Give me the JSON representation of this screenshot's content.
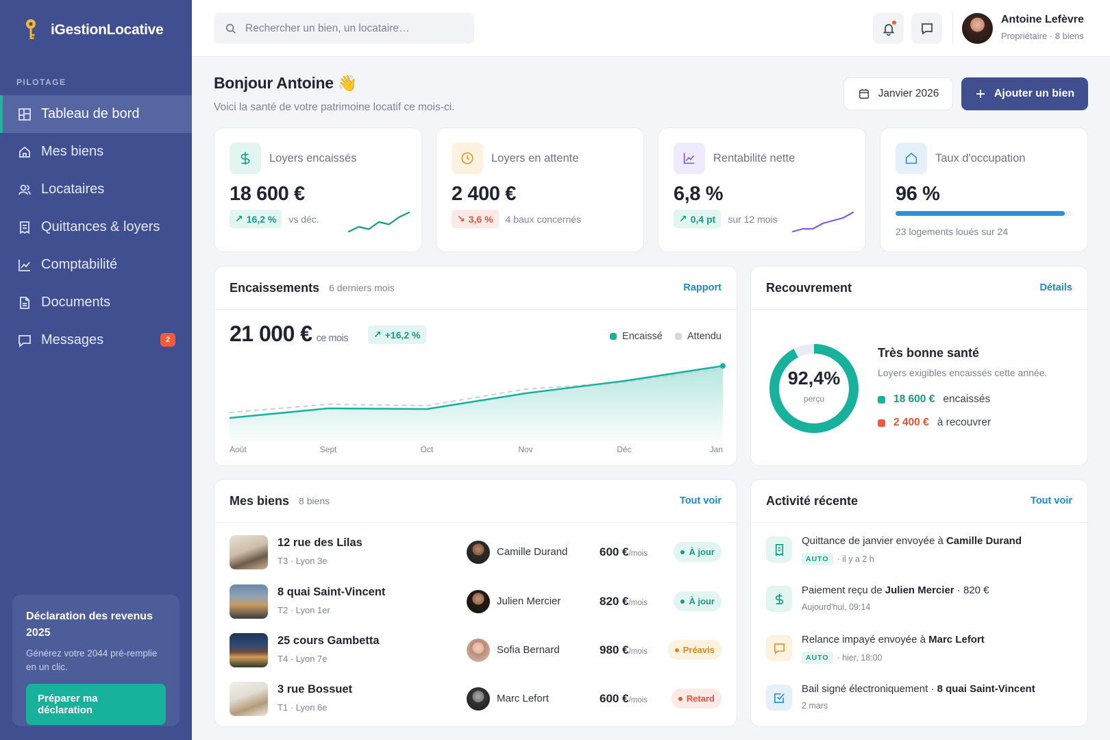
{
  "app": {
    "name": "iGestionLocative"
  },
  "sidebar": {
    "section": "PILOTAGE",
    "items": [
      {
        "label": "Tableau de bord",
        "icon": "dashboard-icon",
        "active": true
      },
      {
        "label": "Mes biens",
        "icon": "home-icon"
      },
      {
        "label": "Locataires",
        "icon": "users-icon"
      },
      {
        "label": "Quittances & loyers",
        "icon": "receipt-icon"
      },
      {
        "label": "Comptabilité",
        "icon": "chart-line-icon"
      },
      {
        "label": "Documents",
        "icon": "document-icon"
      },
      {
        "label": "Messages",
        "icon": "message-icon",
        "badge": "2"
      }
    ],
    "promo": {
      "title": "Déclaration des revenus 2025",
      "text": "Générez votre 2044 pré-remplie en un clic.",
      "button": "Préparer ma déclaration"
    }
  },
  "topbar": {
    "search_placeholder": "Rechercher un bien, un locataire…",
    "user": {
      "name": "Antoine Lefèvre",
      "subtitle": "Propriétaire · 8 biens"
    }
  },
  "header": {
    "greeting": "Bonjour Antoine 👋",
    "subtitle": "Voici la santé de votre patrimoine locatif ce mois-ci.",
    "period": "Janvier 2026",
    "add_button": "Ajouter un bien"
  },
  "kpis": [
    {
      "label": "Loyers encaissés",
      "value": "18 600 €",
      "delta": "16,2 %",
      "trend": "up",
      "note": "vs déc.",
      "color": "#169a87",
      "spark": [
        3,
        5,
        4,
        7,
        6,
        9,
        11
      ]
    },
    {
      "label": "Loyers en attente",
      "value": "2 400 €",
      "delta": "3,6 %",
      "trend": "down",
      "note": "4 baux concernés",
      "color": "#e59a28"
    },
    {
      "label": "Rentabilité nette",
      "value": "6,8 %",
      "delta": "0,4 pt",
      "trend": "up",
      "note": "sur 12 mois",
      "color": "#7b5ce0",
      "spark": [
        2,
        3,
        3,
        5,
        6,
        7,
        9
      ]
    },
    {
      "label": "Taux d'occupation",
      "value": "96 %",
      "progress": 0.96,
      "note": "23 logements loués sur 24",
      "color": "#2e8fd6"
    }
  ],
  "encaissements": {
    "title": "Encaissements",
    "subtitle": "6 derniers mois",
    "link": "Rapport",
    "value": "21 000 €",
    "value_suffix": "ce mois",
    "delta": "+16,2 %",
    "legend": [
      "Encaissé",
      "Attendu"
    ]
  },
  "chart_data": {
    "type": "area",
    "categories": [
      "Août",
      "Sept",
      "Oct",
      "Nov",
      "Déc",
      "Jan"
    ],
    "series": [
      {
        "name": "Encaissé",
        "values": [
          17200,
          17900,
          17850,
          19000,
          19900,
          21000
        ],
        "color": "#18b29c"
      },
      {
        "name": "Attendu",
        "values": [
          17600,
          18200,
          18100,
          19300,
          19800,
          20800
        ],
        "color": "#c8cfdc"
      }
    ],
    "ylim": [
      15500,
      21500
    ]
  },
  "recouvrement": {
    "title": "Recouvrement",
    "link": "Détails",
    "percent": 0.924,
    "percent_label": "92,4%",
    "percent_sub": "perçu",
    "status": "Très bonne santé",
    "text": "Loyers exigibles encaissés cette année.",
    "collected": {
      "amount": "18 600 €",
      "label": "encaissés",
      "color": "#18b29c"
    },
    "pending": {
      "amount": "2 400 €",
      "label": "à recouvrer",
      "color": "#ef5b3c"
    }
  },
  "biens": {
    "title": "Mes biens",
    "subtitle": "8 biens",
    "link": "Tout voir",
    "rows": [
      {
        "address": "12 rue des Lilas",
        "meta": "T3 · Lyon 3e",
        "tenant": "Camille Durand",
        "rent": "600 €",
        "rent_unit": "/mois",
        "status": "À jour",
        "status_type": "ok"
      },
      {
        "address": "8 quai Saint-Vincent",
        "meta": "T2 · Lyon 1er",
        "tenant": "Julien Mercier",
        "rent": "820 €",
        "rent_unit": "/mois",
        "status": "À jour",
        "status_type": "ok"
      },
      {
        "address": "25 cours Gambetta",
        "meta": "T4 · Lyon 7e",
        "tenant": "Sofia Bernard",
        "rent": "980 €",
        "rent_unit": "/mois",
        "status": "Préavis",
        "status_type": "warn"
      },
      {
        "address": "3 rue Bossuet",
        "meta": "T1 · Lyon 6e",
        "tenant": "Marc Lefort",
        "rent": "600 €",
        "rent_unit": "/mois",
        "status": "Retard",
        "status_type": "late"
      }
    ]
  },
  "activite": {
    "title": "Activité récente",
    "link": "Tout voir",
    "items": [
      {
        "text": "Quittance de janvier envoyée à ",
        "bold": "Camille Durand",
        "after": "",
        "auto": "AUTO",
        "time": "· il y a 2 h",
        "icon": "receipt-icon"
      },
      {
        "text": "Paiement reçu de ",
        "bold": "Julien Mercier",
        "after": " · 820 €",
        "auto": "",
        "time": "Aujourd'hui, 09:14",
        "icon": "dollar-icon"
      },
      {
        "text": "Relance impayé envoyée à ",
        "bold": "Marc Lefort",
        "after": "",
        "auto": "AUTO",
        "time": "· hier, 18:00",
        "icon": "message-icon"
      },
      {
        "text": "Bail signé électroniquement · ",
        "bold": "8 quai Saint-Vincent",
        "after": "",
        "auto": "",
        "time": "2 mars",
        "icon": "check-square-icon"
      }
    ]
  }
}
